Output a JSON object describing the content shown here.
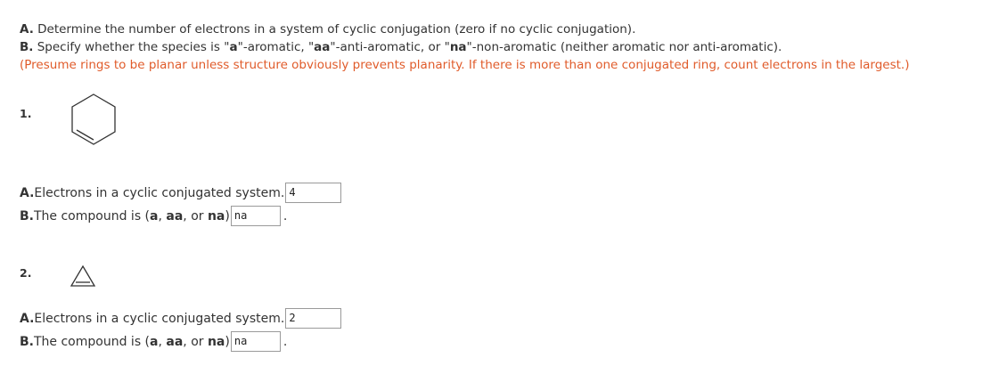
{
  "instructions": {
    "a_label": "A.",
    "a_text": " Determine the number of electrons in a system of cyclic conjugation (zero if no cyclic conjugation).",
    "b_label": "B.",
    "b_text_1": " Specify whether the species is \"",
    "b_a": "a",
    "b_text_2": "\"-aromatic, \"",
    "b_aa": "aa",
    "b_text_3": "\"-anti-aromatic, or \"",
    "b_na": "na",
    "b_text_4": "\"-non-aromatic (neither aromatic nor anti-aromatic).",
    "note": "(Presume rings to be planar unless structure obviously prevents planarity. If there is more than one conjugated ring, count electrons in the largest.)",
    "note_color": "#e05b2a"
  },
  "questions": [
    {
      "number": "1.",
      "structure_icon": "cyclohexene-icon",
      "a_label": "A.",
      "a_text": "Electrons in a cyclic conjugated system.",
      "a_value": "4",
      "b_label": "B.",
      "b_text_1": "The compound is (",
      "b_opt_a": "a",
      "b_sep_1": ", ",
      "b_opt_aa": "aa",
      "b_sep_2": ", or ",
      "b_opt_na": "na",
      "b_text_2": ")",
      "b_value": "na",
      "b_period": "."
    },
    {
      "number": "2.",
      "structure_icon": "cyclopropene-icon",
      "a_label": "A.",
      "a_text": "Electrons in a cyclic conjugated system.",
      "a_value": "2",
      "b_label": "B.",
      "b_text_1": "The compound is (",
      "b_opt_a": "a",
      "b_sep_1": ", ",
      "b_opt_aa": "aa",
      "b_sep_2": ", or ",
      "b_opt_na": "na",
      "b_text_2": ")",
      "b_value": "na",
      "b_period": "."
    }
  ]
}
